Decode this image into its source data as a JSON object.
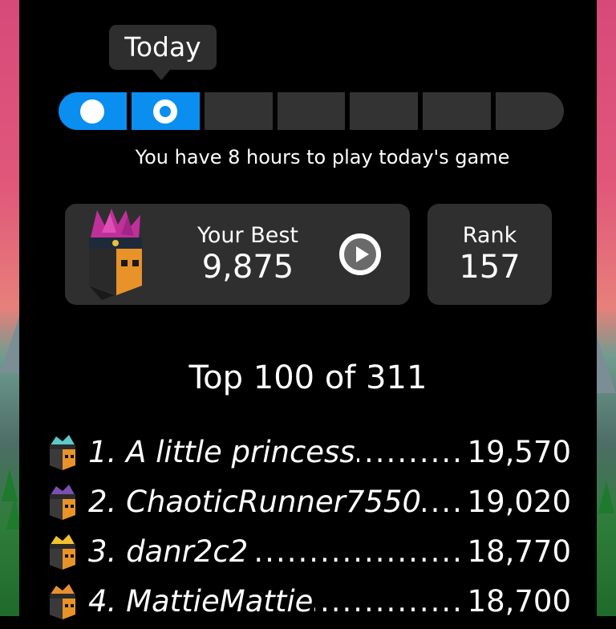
{
  "tooltip": {
    "label": "Today"
  },
  "progress": {
    "segments": 7,
    "completed": 2,
    "current_index": 1
  },
  "hint": "You have 8 hours to play today's game",
  "best": {
    "label": "Your Best",
    "value": "9,875",
    "play_icon": "play-icon"
  },
  "rank": {
    "label": "Rank",
    "value": "157"
  },
  "leaderboard": {
    "title": "Top 100 of 311",
    "rows": [
      {
        "name": "1. A little princess",
        "score": "19,570",
        "hat_color": "#5fc8c8"
      },
      {
        "name": "2. ChaoticRunner7550",
        "score": "19,020",
        "hat_color": "#7a4fb0"
      },
      {
        "name": "3. danr2c2",
        "score": "18,770",
        "hat_color": "#f2c230"
      },
      {
        "name": "4. MattieMattie",
        "score": "18,700",
        "hat_color": "#e89030"
      }
    ]
  },
  "colors": {
    "accent": "#0a8ef0",
    "card": "#2f2f2f",
    "background": "#000000"
  }
}
